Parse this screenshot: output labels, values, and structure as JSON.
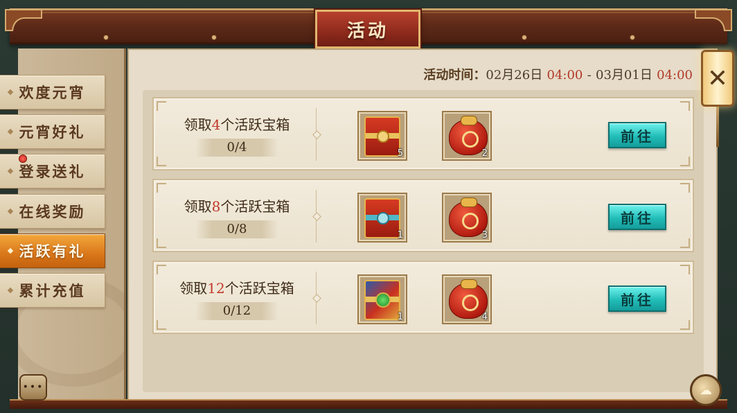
{
  "header": {
    "title": "活动"
  },
  "sidebar": {
    "items": [
      {
        "label": "欢度元宵",
        "active": false
      },
      {
        "label": "元宵好礼",
        "active": false
      },
      {
        "label": "登录送礼",
        "active": false,
        "has_notification_dot": true
      },
      {
        "label": "在线奖励",
        "active": false
      },
      {
        "label": "活跃有礼",
        "active": true
      },
      {
        "label": "累计充值",
        "active": false
      }
    ]
  },
  "activity_time": {
    "label": "活动时间：",
    "start_date": "02月26日",
    "start_time": "04:00",
    "separator": "-",
    "end_date": "03月01日",
    "end_time": "04:00"
  },
  "tasks": [
    {
      "title_prefix": "领取",
      "target": "4",
      "title_suffix": "个活跃宝箱",
      "progress": "0/4",
      "rewards": [
        {
          "icon": "red-gift-box-icon",
          "qty": "5"
        },
        {
          "icon": "red-lucky-bag-icon",
          "qty": "2"
        }
      ],
      "button": "前往"
    },
    {
      "title_prefix": "领取",
      "target": "8",
      "title_suffix": "个活跃宝箱",
      "progress": "0/8",
      "rewards": [
        {
          "icon": "jade-ring-gift-box-icon",
          "qty": "1"
        },
        {
          "icon": "red-lucky-bag-icon",
          "qty": "3"
        }
      ],
      "button": "前往"
    },
    {
      "title_prefix": "领取",
      "target": "12",
      "title_suffix": "个活跃宝箱",
      "progress": "0/12",
      "rewards": [
        {
          "icon": "emerald-gift-box-icon",
          "qty": "1"
        },
        {
          "icon": "red-lucky-bag-icon",
          "qty": "4"
        }
      ],
      "button": "前往"
    }
  ],
  "controls": {
    "close_icon": "close-icon",
    "chat_icon": "chat-bubble-icon",
    "chat_glyph": "•••",
    "extra_icon": "cloud-sun-icon"
  },
  "colors": {
    "accent_red": "#c0392b",
    "active_tab": "#e08a24",
    "go_button": "#22bdb8",
    "title_plaque": "#8d2a1c"
  }
}
